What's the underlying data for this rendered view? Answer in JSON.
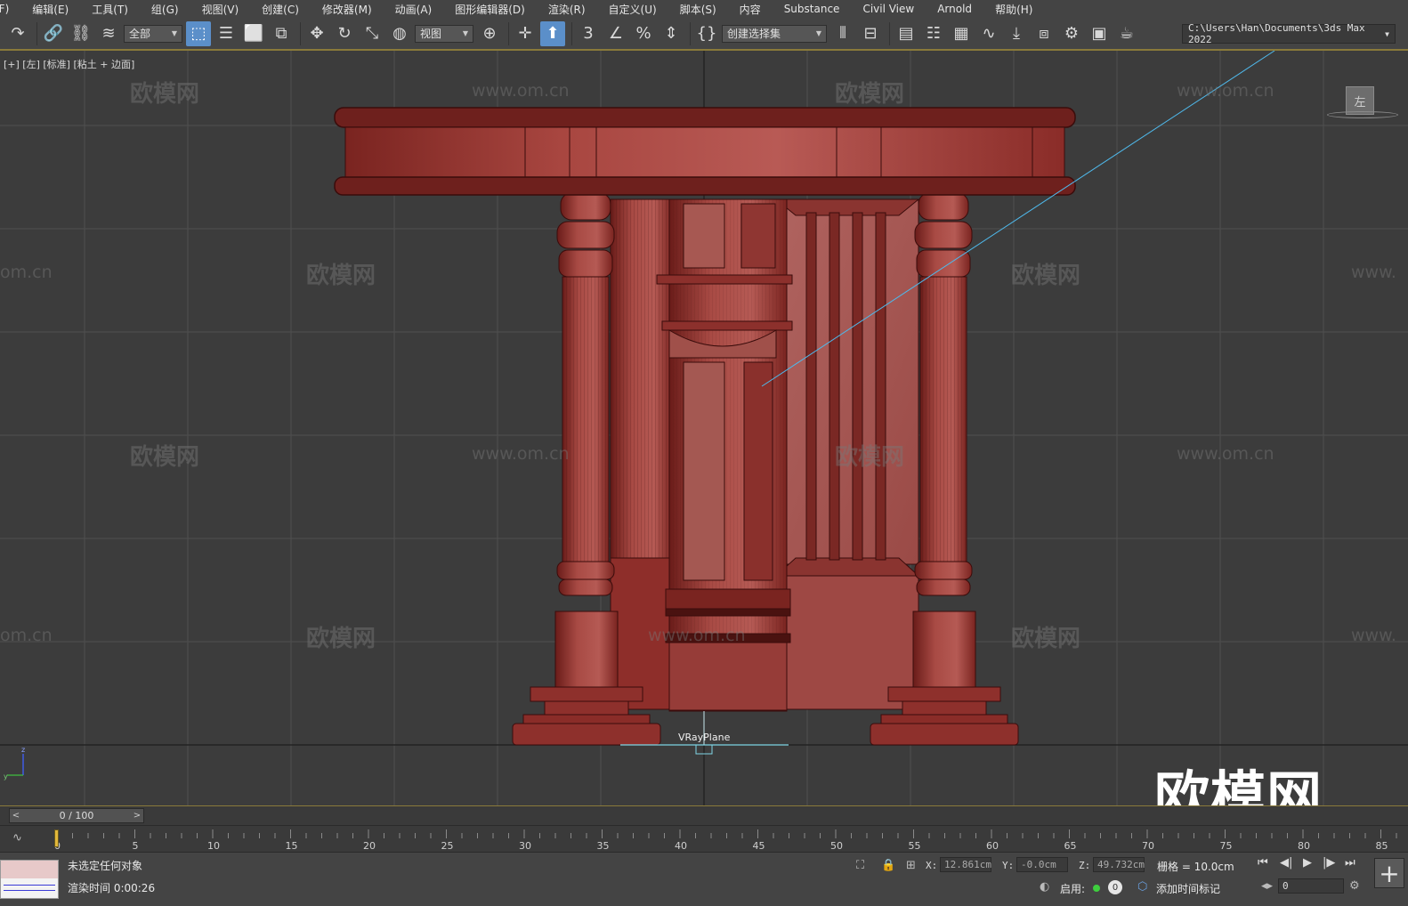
{
  "menubar": {
    "items": [
      {
        "label": "(F)"
      },
      {
        "label": "编辑(E)"
      },
      {
        "label": "工具(T)"
      },
      {
        "label": "组(G)"
      },
      {
        "label": "视图(V)"
      },
      {
        "label": "创建(C)"
      },
      {
        "label": "修改器(M)"
      },
      {
        "label": "动画(A)"
      },
      {
        "label": "图形编辑器(D)"
      },
      {
        "label": "渲染(R)"
      },
      {
        "label": "自定义(U)"
      },
      {
        "label": "脚本(S)"
      },
      {
        "label": "内容"
      },
      {
        "label": "Substance"
      },
      {
        "label": "Civil View"
      },
      {
        "label": "Arnold"
      },
      {
        "label": "帮助(H)"
      }
    ]
  },
  "toolbar": {
    "selection_filter": "全部",
    "reference_coord": "视图",
    "named_selection": "创建选择集",
    "snap_value": "3",
    "project_path": "C:\\Users\\Han\\Documents\\3ds Max 2022"
  },
  "viewport": {
    "label": "[+] [左] [标准] [粘土 + 边面]",
    "viewcube_face": "左",
    "object_label": "VRayPlane",
    "logo_text": "欧模网",
    "watermark_cn": "欧模网",
    "watermark_url": "www.om.cn",
    "watermark_url_cut": "om.cn",
    "watermark_url_right": "www.",
    "axis_z": "z",
    "axis_y": "y",
    "colors": {
      "background": "#3c3c3c",
      "grid": "#4f4f4f",
      "model": "#9e3b36",
      "model_dark": "#6a1e1c",
      "wire": "#3a0c0b",
      "camera_line": "#4fb8ea"
    }
  },
  "timeline": {
    "slider_text": "0 / 100",
    "ticks": [
      "0",
      "5",
      "10",
      "15",
      "20",
      "25",
      "30",
      "35",
      "40",
      "45",
      "50",
      "55",
      "60",
      "65",
      "70",
      "75",
      "80",
      "85"
    ],
    "current_frame": 0
  },
  "statusbar": {
    "selection_status": "未选定任何对象",
    "render_time": "渲染时间  0:00:26",
    "x_label": "X:",
    "x_value": "12.861cm",
    "y_label": "Y:",
    "y_value": "-0.0cm",
    "z_label": "Z:",
    "z_value": "49.732cm",
    "grid": "栅格 = 10.0cm",
    "enable_label": "启用:",
    "add_time_tag": "添加时间标记",
    "frame_value": "0",
    "badge_value": "0"
  }
}
